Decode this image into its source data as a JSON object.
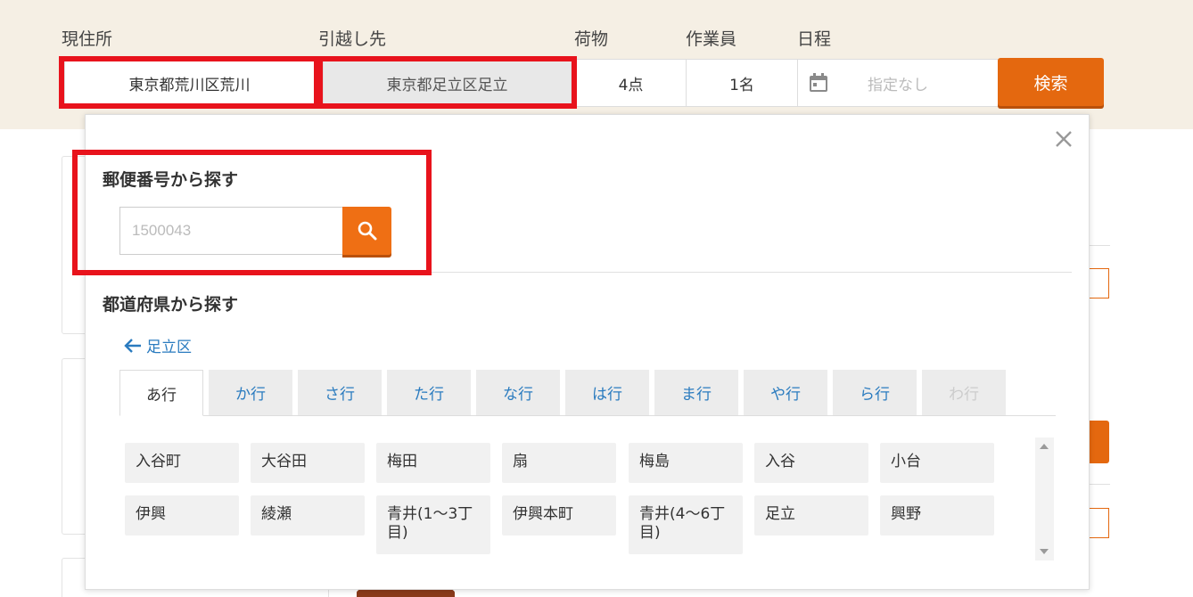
{
  "search": {
    "labels": {
      "current": "現住所",
      "destination": "引越し先",
      "luggage": "荷物",
      "staff": "作業員",
      "schedule": "日程"
    },
    "current_address": "東京都荒川区荒川",
    "destination_address": "東京都足立区足立",
    "luggage_value": "4点",
    "staff_value": "1名",
    "date_placeholder": "指定なし",
    "search_button": "検索"
  },
  "popup": {
    "zip_heading": "郵便番号から探す",
    "zip_placeholder": "1500043",
    "pref_heading": "都道府県から探す",
    "back_link": "足立区",
    "tabs": [
      {
        "label": "あ行",
        "state": "active"
      },
      {
        "label": "か行",
        "state": "normal"
      },
      {
        "label": "さ行",
        "state": "normal"
      },
      {
        "label": "た行",
        "state": "normal"
      },
      {
        "label": "な行",
        "state": "normal"
      },
      {
        "label": "は行",
        "state": "normal"
      },
      {
        "label": "ま行",
        "state": "normal"
      },
      {
        "label": "や行",
        "state": "normal"
      },
      {
        "label": "ら行",
        "state": "normal"
      },
      {
        "label": "わ行",
        "state": "disabled"
      }
    ],
    "towns": [
      "入谷町",
      "大谷田",
      "梅田",
      "扇",
      "梅島",
      "入谷",
      "小台",
      "伊興",
      "綾瀬",
      "青井(1～3丁目)",
      "伊興本町",
      "青井(4～6丁目)",
      "足立",
      "興野"
    ]
  },
  "colors": {
    "accent": "#e4680f",
    "highlight": "#e8131c",
    "link": "#2a7bbf",
    "band": "#f5efe4"
  }
}
